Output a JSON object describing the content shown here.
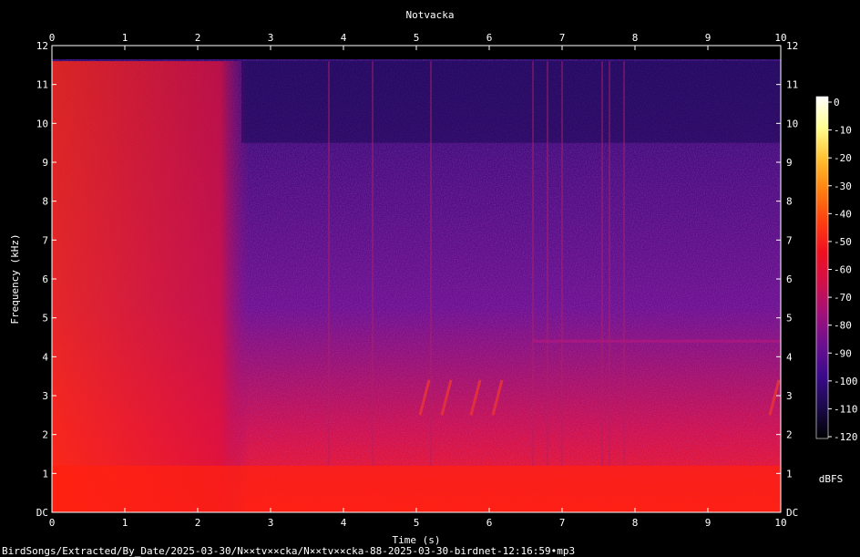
{
  "chart_data": {
    "type": "heatmap",
    "title": "Notvacka",
    "xlabel": "Time (s)",
    "ylabel": "Frequency (kHz)",
    "xlim": [
      0,
      10
    ],
    "ylim": [
      0,
      12
    ],
    "x_ticks": [
      "0",
      "1",
      "2",
      "3",
      "4",
      "5",
      "6",
      "7",
      "8",
      "9",
      "10"
    ],
    "y_ticks": [
      "DC",
      "1",
      "2",
      "3",
      "4",
      "5",
      "6",
      "7",
      "8",
      "9",
      "10",
      "11",
      "12"
    ],
    "colorbar": {
      "label": "dBFS",
      "ticks": [
        "0",
        "-10",
        "-20",
        "-30",
        "-40",
        "-50",
        "-60",
        "-70",
        "-80",
        "-90",
        "-100",
        "-110",
        "-120"
      ],
      "range": [
        -120,
        0
      ],
      "colors": [
        "#000000",
        "#1a0a4a",
        "#3a0a8a",
        "#6a1090",
        "#a0107a",
        "#d0104a",
        "#f01020",
        "#ff4010",
        "#ff8010",
        "#ffc030",
        "#ffff90",
        "#ffffff"
      ]
    },
    "signal_summary": {
      "broadband_loud_segment_s": [
        0,
        2.4
      ],
      "low_frequency_band_khz": [
        0,
        1.2
      ],
      "horizontal_tone_khz": 4.4,
      "chirps": [
        {
          "time_s": 5.05,
          "freq_khz": [
            2.5,
            3.4
          ]
        },
        {
          "time_s": 5.35,
          "freq_khz": [
            2.5,
            3.4
          ]
        },
        {
          "time_s": 5.75,
          "freq_khz": [
            2.5,
            3.4
          ]
        },
        {
          "time_s": 6.05,
          "freq_khz": [
            2.5,
            3.4
          ]
        },
        {
          "time_s": 9.85,
          "freq_khz": [
            2.5,
            3.4
          ]
        }
      ],
      "transients_s": [
        3.8,
        4.4,
        5.2,
        6.6,
        6.8,
        7.0,
        7.55,
        7.65,
        7.85
      ]
    }
  },
  "footer": {
    "file_path": "BirdSongs/Extracted/By_Date/2025-03-30/N××tv××cka/N××tv××cka-88-2025-03-30-birdnet-12:16:59•mp3"
  }
}
